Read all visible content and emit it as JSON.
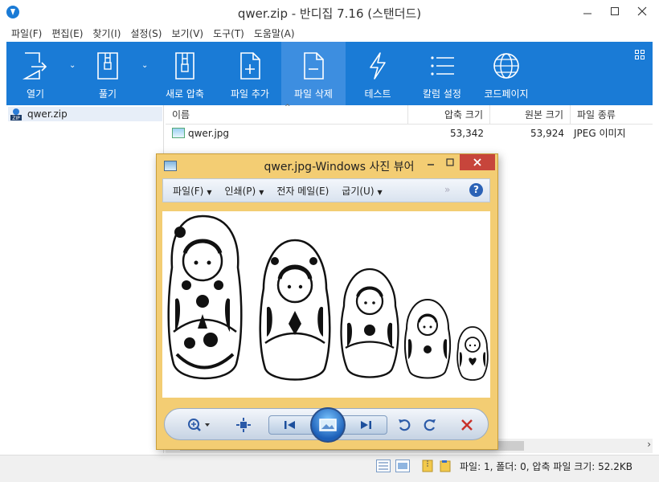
{
  "window": {
    "title": "qwer.zip - 반디집 7.16 (스탠더드)"
  },
  "menu": [
    "파일(F)",
    "편집(E)",
    "찾기(I)",
    "설정(S)",
    "보기(V)",
    "도구(T)",
    "도움말(A)"
  ],
  "toolbar": {
    "open": "열기",
    "extract": "풀기",
    "new_archive": "새로 압축",
    "add_file": "파일 추가",
    "delete_file": "파일 삭제",
    "test": "테스트",
    "column_settings": "칼럼 설정",
    "codepage": "코드페이지"
  },
  "tree": {
    "root": "qwer.zip"
  },
  "list": {
    "columns": [
      "이름",
      "압축 크기",
      "원본 크기",
      "파일 종류"
    ],
    "rows": [
      {
        "name": "qwer.jpg",
        "packed": "53,342",
        "size": "53,924",
        "type": "JPEG 이미지"
      }
    ]
  },
  "status": {
    "text": "파일: 1, 폴더: 0, 압축 파일 크기: 52.2KB"
  },
  "viewer": {
    "title": "qwer.jpg-Windows 사진 뷰어",
    "menu": [
      "파일(F)",
      "인쇄(P)",
      "전자 메일(E)",
      "굽기(U)"
    ],
    "more": "»",
    "help": "?"
  },
  "colors": {
    "toolbar": "#1a7bd6",
    "toolbar_active": "#3d8ee0",
    "viewer_frame": "#f3cd73",
    "viewer_close": "#c7453b"
  }
}
